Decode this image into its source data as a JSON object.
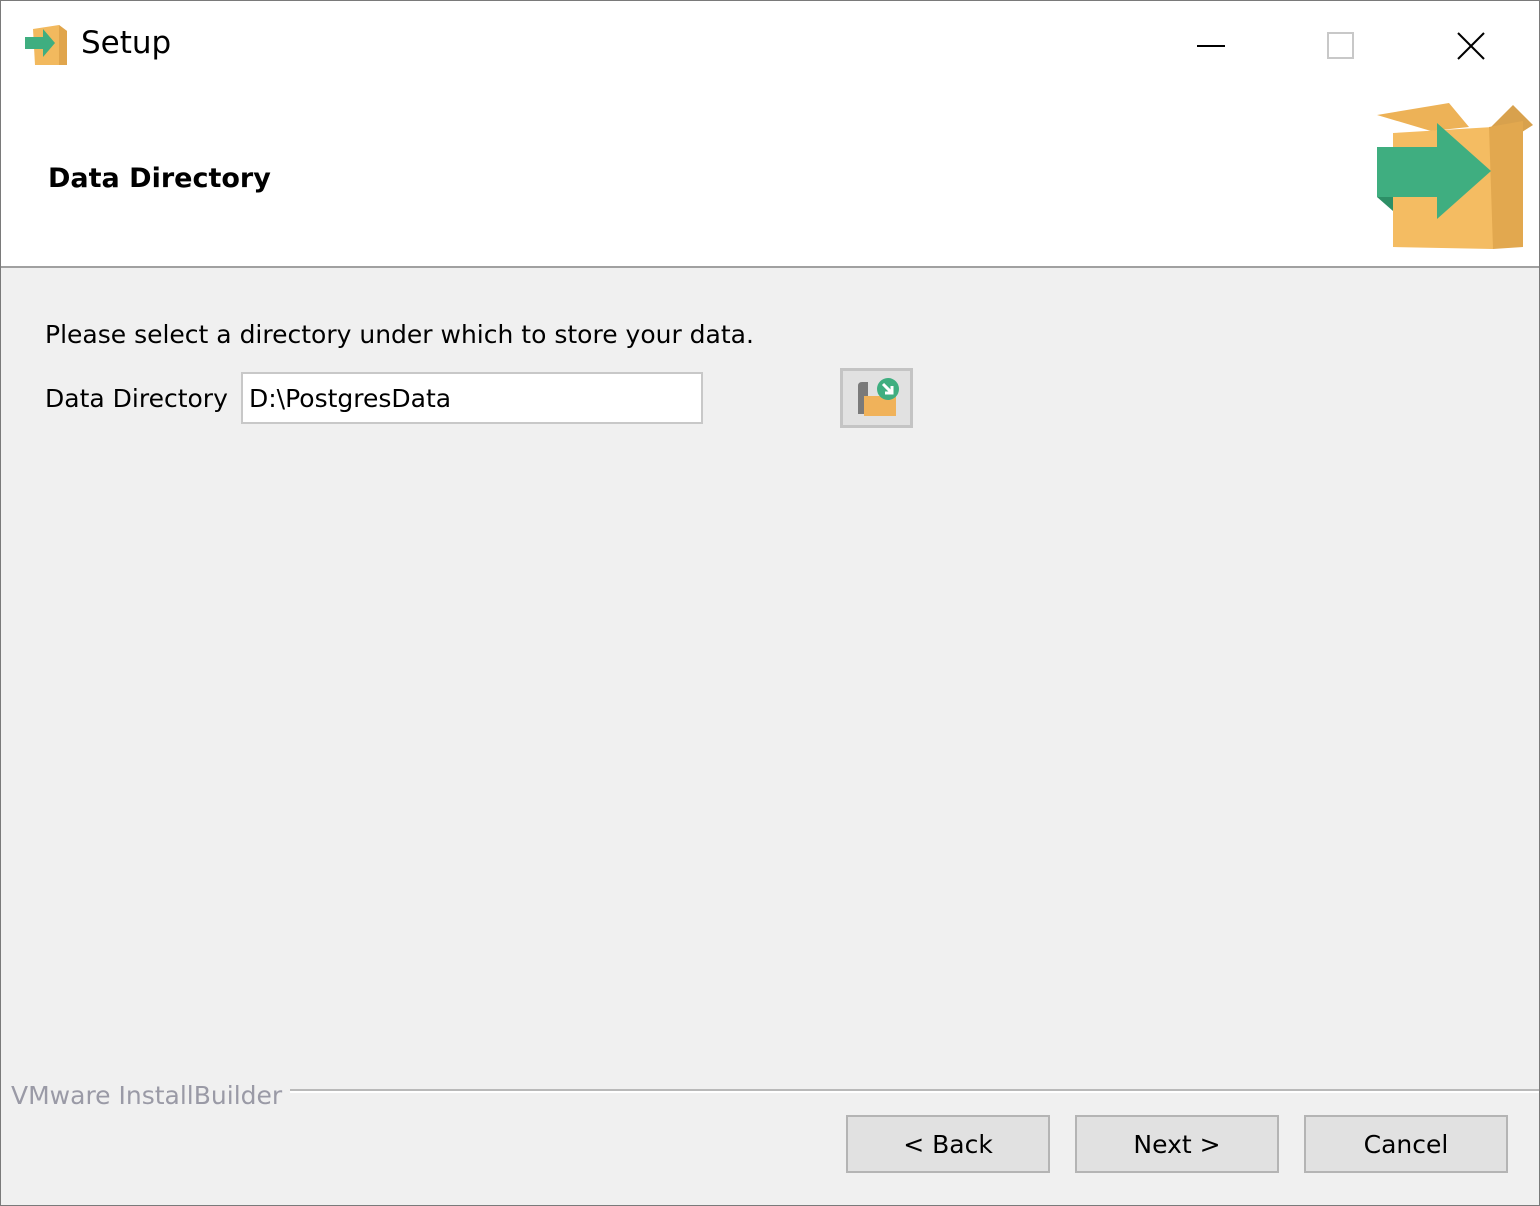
{
  "window": {
    "title": "Setup",
    "app_icon": "installer-box-arrow-icon",
    "controls": {
      "minimize": "minimize-icon",
      "maximize": "maximize-icon",
      "close": "close-icon"
    }
  },
  "header": {
    "title": "Data Directory",
    "logo": "installer-box-arrow-icon"
  },
  "content": {
    "prompt": "Please select a directory under which to store your data.",
    "field_label": "Data Directory",
    "field_value": "D:\\PostgresData",
    "browse_icon": "folder-browse-icon"
  },
  "footer": {
    "brand": "VMware InstallBuilder",
    "buttons": {
      "back": "< Back",
      "next": "Next >",
      "cancel": "Cancel"
    }
  },
  "colors": {
    "arrow_green": "#3fae80",
    "box_orange": "#f2b95e",
    "panel_bg": "#f0f0f0"
  }
}
